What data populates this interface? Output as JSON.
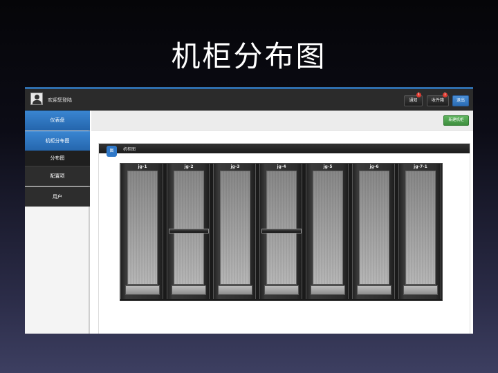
{
  "slide": {
    "title": "机柜分布图"
  },
  "header": {
    "welcome_text": "欢迎您登陆",
    "notice_label": "通知",
    "notice_badge": "1",
    "inbox_label": "收件箱",
    "inbox_badge": "1",
    "logout_label": "退出"
  },
  "sidebar": {
    "items": [
      {
        "label": "仪表盘"
      },
      {
        "label": "机柜分布图"
      },
      {
        "label": "分布图"
      },
      {
        "label": "配置项"
      },
      {
        "label": "用户"
      }
    ]
  },
  "toolbar": {
    "new_rack_label": "新建机柜"
  },
  "panel": {
    "icon_text": "图",
    "title": "机柜图"
  },
  "racks": [
    {
      "label": "jg-1",
      "has_device": false
    },
    {
      "label": "jg-2",
      "has_device": true
    },
    {
      "label": "jg-3",
      "has_device": false
    },
    {
      "label": "jg-4",
      "has_device": true
    },
    {
      "label": "jg-5",
      "has_device": false
    },
    {
      "label": "jg-6",
      "has_device": false
    },
    {
      "label": "jg-7-1",
      "has_device": false
    }
  ],
  "colors": {
    "accent": "#2f78c8",
    "success": "#4a9f4a",
    "badge": "#e03a30"
  }
}
